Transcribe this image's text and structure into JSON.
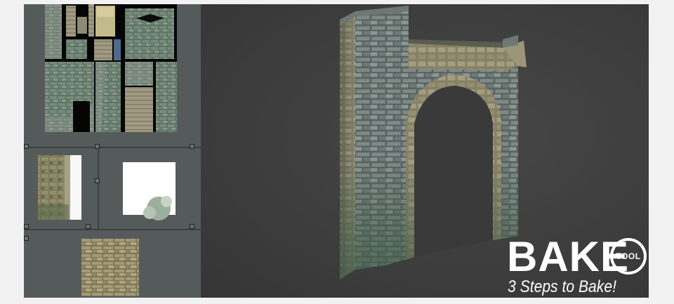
{
  "logo": {
    "wordmark": "BAKE",
    "badge": "TOOL"
  },
  "tagline": "3 Steps to Bake!",
  "colors": {
    "background": "#f2f2f2",
    "viewport": "#3e3e3e",
    "panel": "#555a5a",
    "text": "#ffffff"
  },
  "panels": {
    "texture_atlas": "stone-texture-atlas",
    "ao_map": "wall-ao-thumbnail",
    "mask_map": "white-mask-thumbnail",
    "stone_tile": "stone-tile-thumbnail"
  }
}
